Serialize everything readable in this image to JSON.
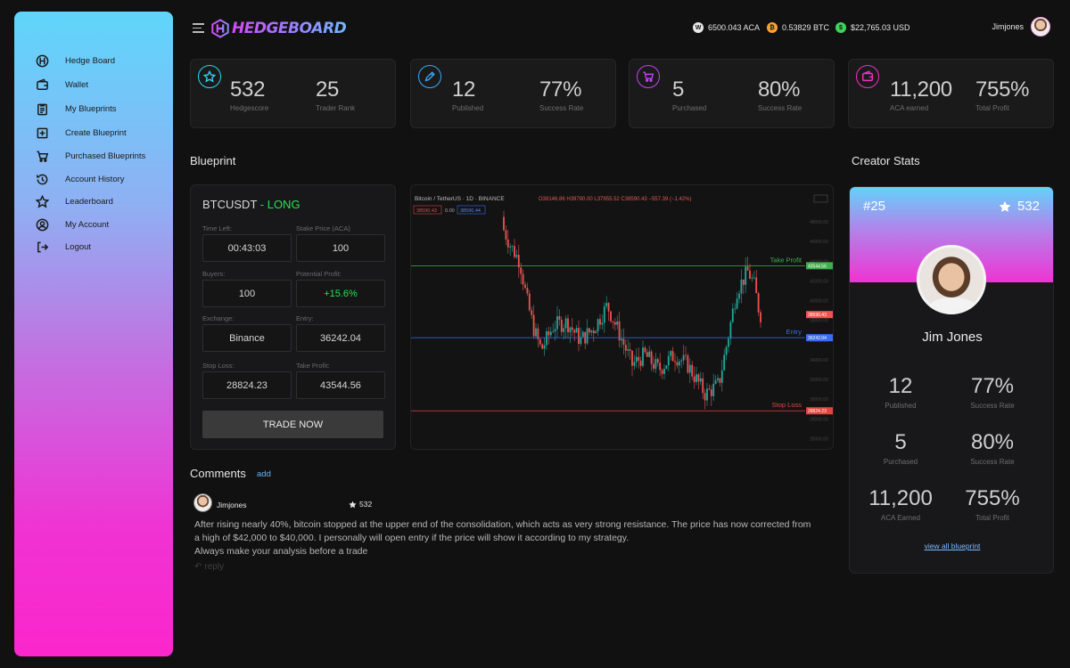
{
  "app": {
    "logo_text": "HEDGEBOARD"
  },
  "sidebar": {
    "items": [
      {
        "label": "Hedge Board",
        "icon": "hedgeboard-icon"
      },
      {
        "label": "Wallet",
        "icon": "wallet-icon"
      },
      {
        "label": "My Blueprints",
        "icon": "clipboard-icon"
      },
      {
        "label": "Create Blueprint",
        "icon": "plus-square-icon"
      },
      {
        "label": "Purchased Blueprints",
        "icon": "cart-icon"
      },
      {
        "label": "Account History",
        "icon": "history-icon"
      },
      {
        "label": "Leaderboard",
        "icon": "star-icon"
      },
      {
        "label": "My Account",
        "icon": "user-circle-icon"
      },
      {
        "label": "Logout",
        "icon": "logout-icon"
      }
    ]
  },
  "header": {
    "balances": [
      {
        "text": "6500.043 ACA",
        "icon": "aca-coin-icon",
        "color": "#e8e8e8"
      },
      {
        "text": "0.53829 BTC",
        "icon": "btc-coin-icon",
        "color": "#f7a334"
      },
      {
        "text": "$22,765.03 USD",
        "icon": "usd-coin-icon",
        "color": "#3fd45a"
      }
    ],
    "username": "Jimjones"
  },
  "stats": [
    {
      "icon": "star-icon",
      "color": "#27d6f2",
      "a_val": "532",
      "a_lbl": "Hedgescore",
      "b_val": "25",
      "b_lbl": "Trader Rank"
    },
    {
      "icon": "pencil-icon",
      "color": "#3aa9f5",
      "a_val": "12",
      "a_lbl": "Published",
      "b_val": "77%",
      "b_lbl": "Success Rate"
    },
    {
      "icon": "cart-icon",
      "color": "#c640f3",
      "a_val": "5",
      "a_lbl": "Purchased",
      "b_val": "80%",
      "b_lbl": "Success Rate"
    },
    {
      "icon": "wallet-icon",
      "color": "#f22fc3",
      "a_val": "11,200",
      "a_lbl": "ACA earned",
      "b_val": "755%",
      "b_lbl": "Total Profit"
    }
  ],
  "blueprint": {
    "section_title": "Blueprint",
    "pair": "BTCUSDT",
    "separator": " - ",
    "direction": "LONG",
    "fields": [
      {
        "label": "Time Left:",
        "value": "00:43:03"
      },
      {
        "label": "Stake Price (ACA)",
        "value": "100"
      },
      {
        "label": "Buyers:",
        "value": "100"
      },
      {
        "label": "Potential Profit:",
        "value": "+15.6%"
      },
      {
        "label": "Exchange:",
        "value": "Binance"
      },
      {
        "label": "Entry:",
        "value": "36242.04"
      },
      {
        "label": "Stop Loss:",
        "value": "28824.23"
      },
      {
        "label": "Take Profit:",
        "value": "43544.56"
      }
    ],
    "trade_button": "TRADE NOW"
  },
  "chart": {
    "header": "Bitcoin / TetherUS · 1D · BINANCE",
    "ohlc": "O39146.86 H39780.00 L37955.52 C38590.43 −557.39 (−1.42%)",
    "tag_left": "38590.43",
    "tag_mid": "0.00",
    "tag_right": "38590.44",
    "lines": [
      {
        "label": "Take Profit",
        "price": "43544.56",
        "color": "#3fae4c"
      },
      {
        "label": "Entry",
        "price": "36242.04",
        "color": "#3b6cf0"
      },
      {
        "label": "Stop Loss",
        "price": "28824.23",
        "color": "#e0463e"
      }
    ],
    "last_price": "38590.43",
    "axis_ticks": [
      "48000.00",
      "46000.00",
      "44000.00",
      "42000.00",
      "40000.00",
      "38000.00",
      "36000.00",
      "34000.00",
      "32000.00",
      "30000.00",
      "28000.00",
      "26000.00"
    ]
  },
  "comments": {
    "title": "Comments",
    "add_label": "add",
    "user": "Jimjones",
    "score": "532",
    "lines": [
      "After rising nearly 40%, bitcoin stopped at the upper end of the consolidation, which acts as very strong resistance. The price has now corrected from",
      "a high of $42,000 to $40,000. I personally will open entry if the price will show it according to my strategy.",
      "Always make your analysis before a trade"
    ],
    "reply_label": "reply"
  },
  "creator": {
    "section_title": "Creator Stats",
    "rank": "#25",
    "score": "532",
    "name": "Jim Jones",
    "stats": [
      {
        "value": "12",
        "label": "Published"
      },
      {
        "value": "77%",
        "label": "Success Rate"
      },
      {
        "value": "5",
        "label": "Purchased"
      },
      {
        "value": "80%",
        "label": "Success Rate"
      },
      {
        "value": "11,200",
        "label": "ACA Earned"
      },
      {
        "value": "755%",
        "label": "Total Profit"
      }
    ],
    "view_all": "view all blueprint"
  }
}
